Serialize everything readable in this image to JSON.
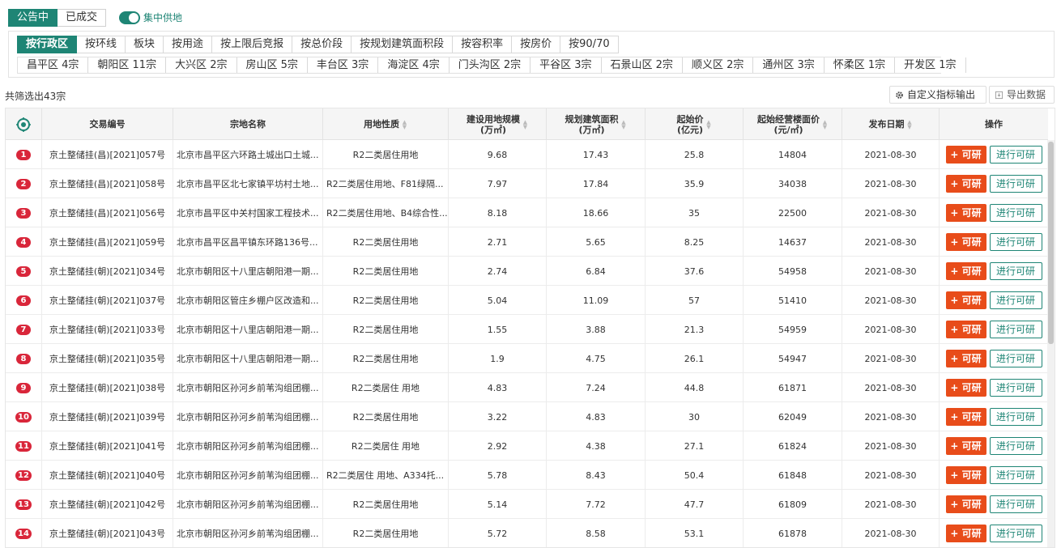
{
  "status_tabs": [
    {
      "label": "公告中",
      "active": true
    },
    {
      "label": "已成交",
      "active": false
    }
  ],
  "toggle": {
    "label": "集中供地",
    "on": true
  },
  "dimension_tabs": [
    "按行政区",
    "按环线",
    "板块",
    "按用途",
    "按上限后竞报",
    "按总价段",
    "按规划建筑面积段",
    "按容积率",
    "按房价",
    "按90/70"
  ],
  "districts": [
    "昌平区 4宗",
    "朝阳区 11宗",
    "大兴区 2宗",
    "房山区 5宗",
    "丰台区 3宗",
    "海淀区 4宗",
    "门头沟区 2宗",
    "平谷区 3宗",
    "石景山区 2宗",
    "顺义区 2宗",
    "通州区 3宗",
    "怀柔区 1宗",
    "开发区 1宗"
  ],
  "summary": {
    "count_text": "共筛选出43宗"
  },
  "actions": {
    "custom_label": "自定义指标输出",
    "export_label": "导出数据"
  },
  "table": {
    "headers": {
      "code": "交易编号",
      "name": "宗地名称",
      "usage": "用地性质",
      "land_scale_1": "建设用地规模",
      "land_scale_2": "(万㎡)",
      "build_area_1": "规划建筑面积",
      "build_area_2": "(万㎡)",
      "start_price_1": "起始价",
      "start_price_2": "(亿元)",
      "floor_price_1": "起始经营楼面价",
      "floor_price_2": "(元/㎡)",
      "date": "发布日期",
      "ops": "操作"
    },
    "add_label": "+ 可研",
    "research_label": "进行可研",
    "rows": [
      {
        "no": "1",
        "code": "京土整储挂(昌)[2021]057号",
        "name": "北京市昌平区六环路土城出口土城...",
        "usage": "R2二类居住用地",
        "land": "9.68",
        "area": "17.43",
        "price": "25.8",
        "floor": "14804",
        "date": "2021-08-30"
      },
      {
        "no": "2",
        "code": "京土整储挂(昌)[2021]058号",
        "name": "北京市昌平区北七家镇平坊村土地...",
        "usage": "R2二类居住用地、F81绿隔...",
        "land": "7.97",
        "area": "17.84",
        "price": "35.9",
        "floor": "34038",
        "date": "2021-08-30"
      },
      {
        "no": "3",
        "code": "京土整储挂(昌)[2021]056号",
        "name": "北京市昌平区中关村国家工程技术...",
        "usage": "R2二类居住用地、B4综合性...",
        "land": "8.18",
        "area": "18.66",
        "price": "35",
        "floor": "22500",
        "date": "2021-08-30"
      },
      {
        "no": "4",
        "code": "京土整储挂(昌)[2021]059号",
        "name": "北京市昌平区昌平镇东环路136号...",
        "usage": "R2二类居住用地",
        "land": "2.71",
        "area": "5.65",
        "price": "8.25",
        "floor": "14637",
        "date": "2021-08-30"
      },
      {
        "no": "5",
        "code": "京土整储挂(朝)[2021]034号",
        "name": "北京市朝阳区十八里店朝阳港一期...",
        "usage": "R2二类居住用地",
        "land": "2.74",
        "area": "6.84",
        "price": "37.6",
        "floor": "54958",
        "date": "2021-08-30"
      },
      {
        "no": "6",
        "code": "京土整储挂(朝)[2021]037号",
        "name": "北京市朝阳区管庄乡棚户区改造和...",
        "usage": "R2二类居住用地",
        "land": "5.04",
        "area": "11.09",
        "price": "57",
        "floor": "51410",
        "date": "2021-08-30"
      },
      {
        "no": "7",
        "code": "京土整储挂(朝)[2021]033号",
        "name": "北京市朝阳区十八里店朝阳港一期...",
        "usage": "R2二类居住用地",
        "land": "1.55",
        "area": "3.88",
        "price": "21.3",
        "floor": "54959",
        "date": "2021-08-30"
      },
      {
        "no": "8",
        "code": "京土整储挂(朝)[2021]035号",
        "name": "北京市朝阳区十八里店朝阳港一期...",
        "usage": "R2二类居住用地",
        "land": "1.9",
        "area": "4.75",
        "price": "26.1",
        "floor": "54947",
        "date": "2021-08-30"
      },
      {
        "no": "9",
        "code": "京土整储挂(朝)[2021]038号",
        "name": "北京市朝阳区孙河乡前苇沟组团棚...",
        "usage": "R2二类居住 用地",
        "land": "4.83",
        "area": "7.24",
        "price": "44.8",
        "floor": "61871",
        "date": "2021-08-30"
      },
      {
        "no": "10",
        "code": "京土整储挂(朝)[2021]039号",
        "name": "北京市朝阳区孙河乡前苇沟组团棚...",
        "usage": "R2二类居住用地",
        "land": "3.22",
        "area": "4.83",
        "price": "30",
        "floor": "62049",
        "date": "2021-08-30"
      },
      {
        "no": "11",
        "code": "京土整储挂(朝)[2021]041号",
        "name": "北京市朝阳区孙河乡前苇沟组团棚...",
        "usage": "R2二类居住 用地",
        "land": "2.92",
        "area": "4.38",
        "price": "27.1",
        "floor": "61824",
        "date": "2021-08-30"
      },
      {
        "no": "12",
        "code": "京土整储挂(朝)[2021]040号",
        "name": "北京市朝阳区孙河乡前苇沟组团棚...",
        "usage": "R2二类居住 用地、A334托...",
        "land": "5.78",
        "area": "8.43",
        "price": "50.4",
        "floor": "61848",
        "date": "2021-08-30"
      },
      {
        "no": "13",
        "code": "京土整储挂(朝)[2021]042号",
        "name": "北京市朝阳区孙河乡前苇沟组团棚...",
        "usage": "R2二类居住用地",
        "land": "5.14",
        "area": "7.72",
        "price": "47.7",
        "floor": "61809",
        "date": "2021-08-30"
      },
      {
        "no": "14",
        "code": "京土整储挂(朝)[2021]043号",
        "name": "北京市朝阳区孙河乡前苇沟组团棚...",
        "usage": "R2二类居住用地",
        "land": "5.72",
        "area": "8.58",
        "price": "53.1",
        "floor": "61878",
        "date": "2021-08-30"
      }
    ]
  },
  "colors": {
    "accent": "#1e8575",
    "add_button": "#e84c1a",
    "badge": "#d9263a"
  }
}
